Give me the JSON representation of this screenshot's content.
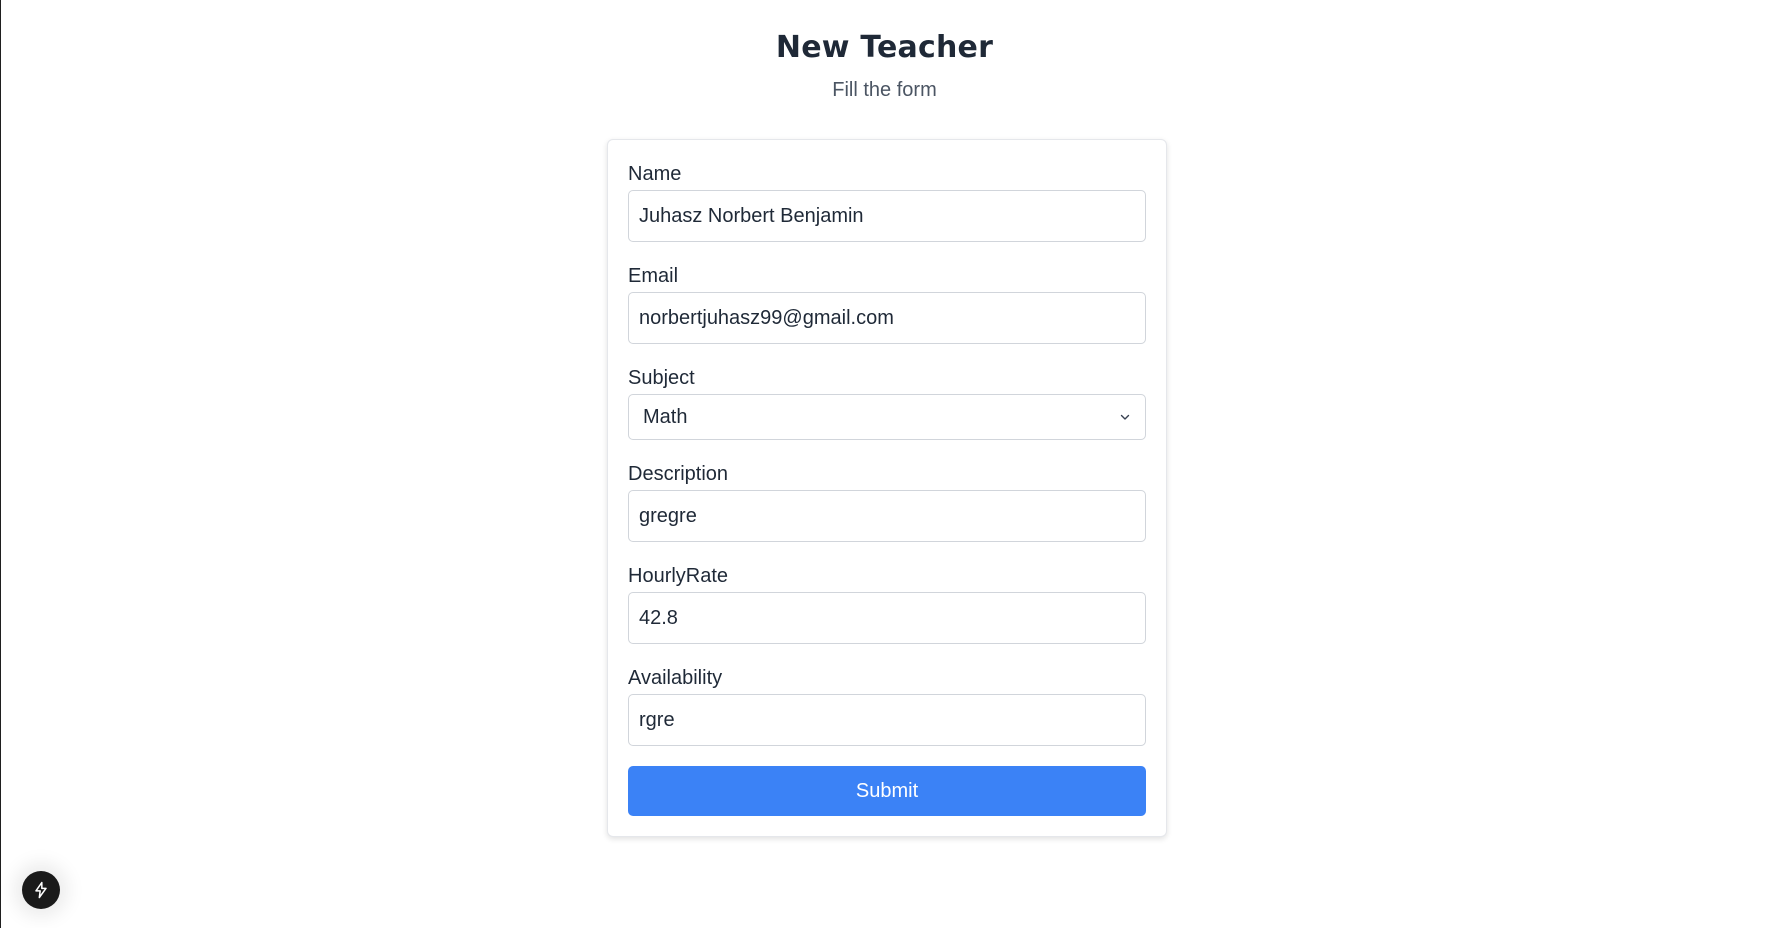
{
  "header": {
    "title": "New Teacher",
    "subtitle": "Fill the form"
  },
  "form": {
    "name": {
      "label": "Name",
      "value": "Juhasz Norbert Benjamin"
    },
    "email": {
      "label": "Email",
      "value": "norbertjuhasz99@gmail.com"
    },
    "subject": {
      "label": "Subject",
      "value": "Math"
    },
    "description": {
      "label": "Description",
      "value": "gregre"
    },
    "hourly_rate": {
      "label": "HourlyRate",
      "value": "42.8"
    },
    "availability": {
      "label": "Availability",
      "value": "rgre"
    },
    "submit_label": "Submit"
  },
  "devtools": {
    "icon": "lightning-icon"
  },
  "colors": {
    "accent": "#3b82f6",
    "text": "#1f2937",
    "muted": "#4b5563",
    "border": "#d1d5db"
  }
}
